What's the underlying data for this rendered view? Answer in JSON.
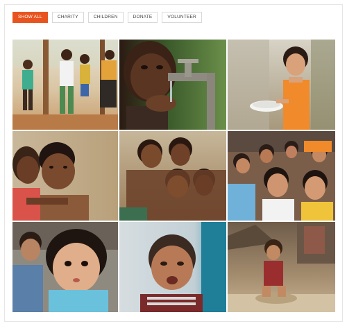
{
  "filters": {
    "show_all": "SHOW ALL",
    "charity": "CHARITY",
    "children": "CHILDREN",
    "donate": "DONATE",
    "volunteer": "VOLUNTEER"
  },
  "active_filter": "SHOW ALL",
  "colors": {
    "accent": "#e8541f",
    "border": "#d9d9d9"
  }
}
